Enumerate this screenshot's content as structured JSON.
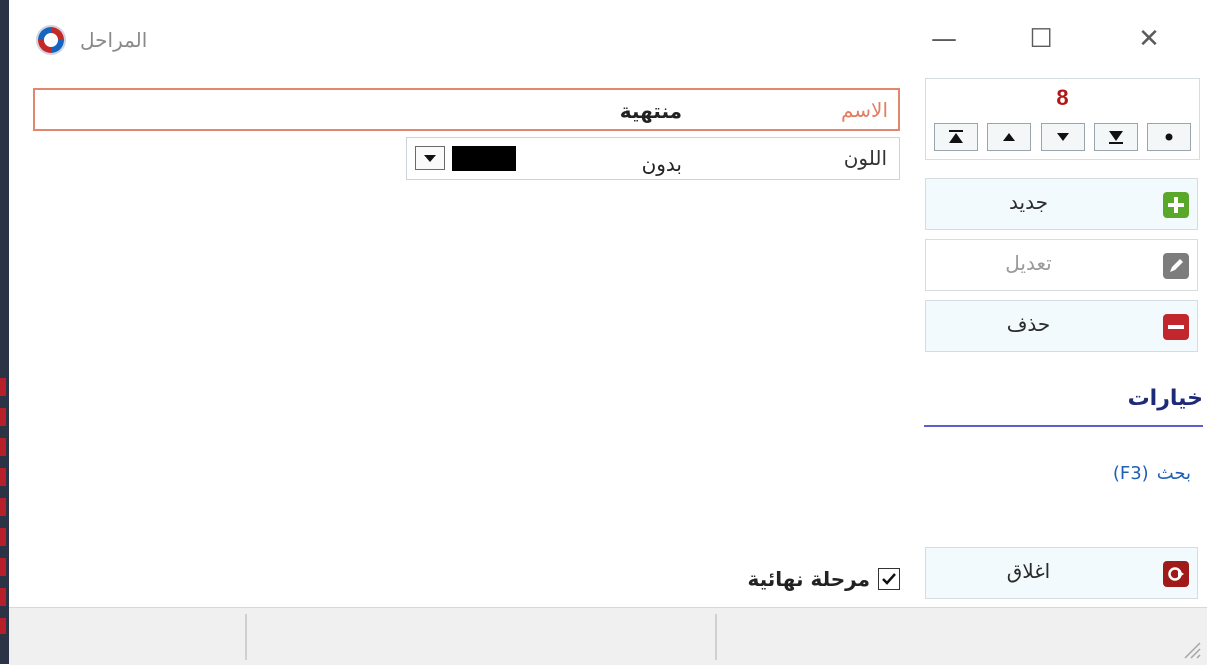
{
  "window": {
    "title": "المراحل",
    "controls": {
      "minimize": "—",
      "maximize": "☐",
      "close": "✕"
    }
  },
  "navigator": {
    "count": "8",
    "buttons": [
      "last-record",
      "next-record",
      "prev-record",
      "first-record",
      "current-record"
    ]
  },
  "actions": {
    "new_label": "جديد",
    "edit_label": "تعديل",
    "delete_label": "حذف",
    "close_label": "اغلاق"
  },
  "options": {
    "title": "خيارات",
    "search_label": "بحث",
    "search_shortcut": "(F3)"
  },
  "form": {
    "name_label": "الاسم",
    "name_value": "منتهية",
    "color_label": "اللون",
    "color_value": "بدون",
    "color_swatch": "#000000",
    "final_stage_label": "مرحلة نهائية",
    "final_stage_checked": true
  },
  "statusbar": {
    "cells": [
      "",
      "",
      ""
    ]
  },
  "colors": {
    "accent_red": "#b01818",
    "link_blue": "#1f5fb4",
    "options_underline": "#5d5fd1",
    "name_border": "#e2876e"
  }
}
